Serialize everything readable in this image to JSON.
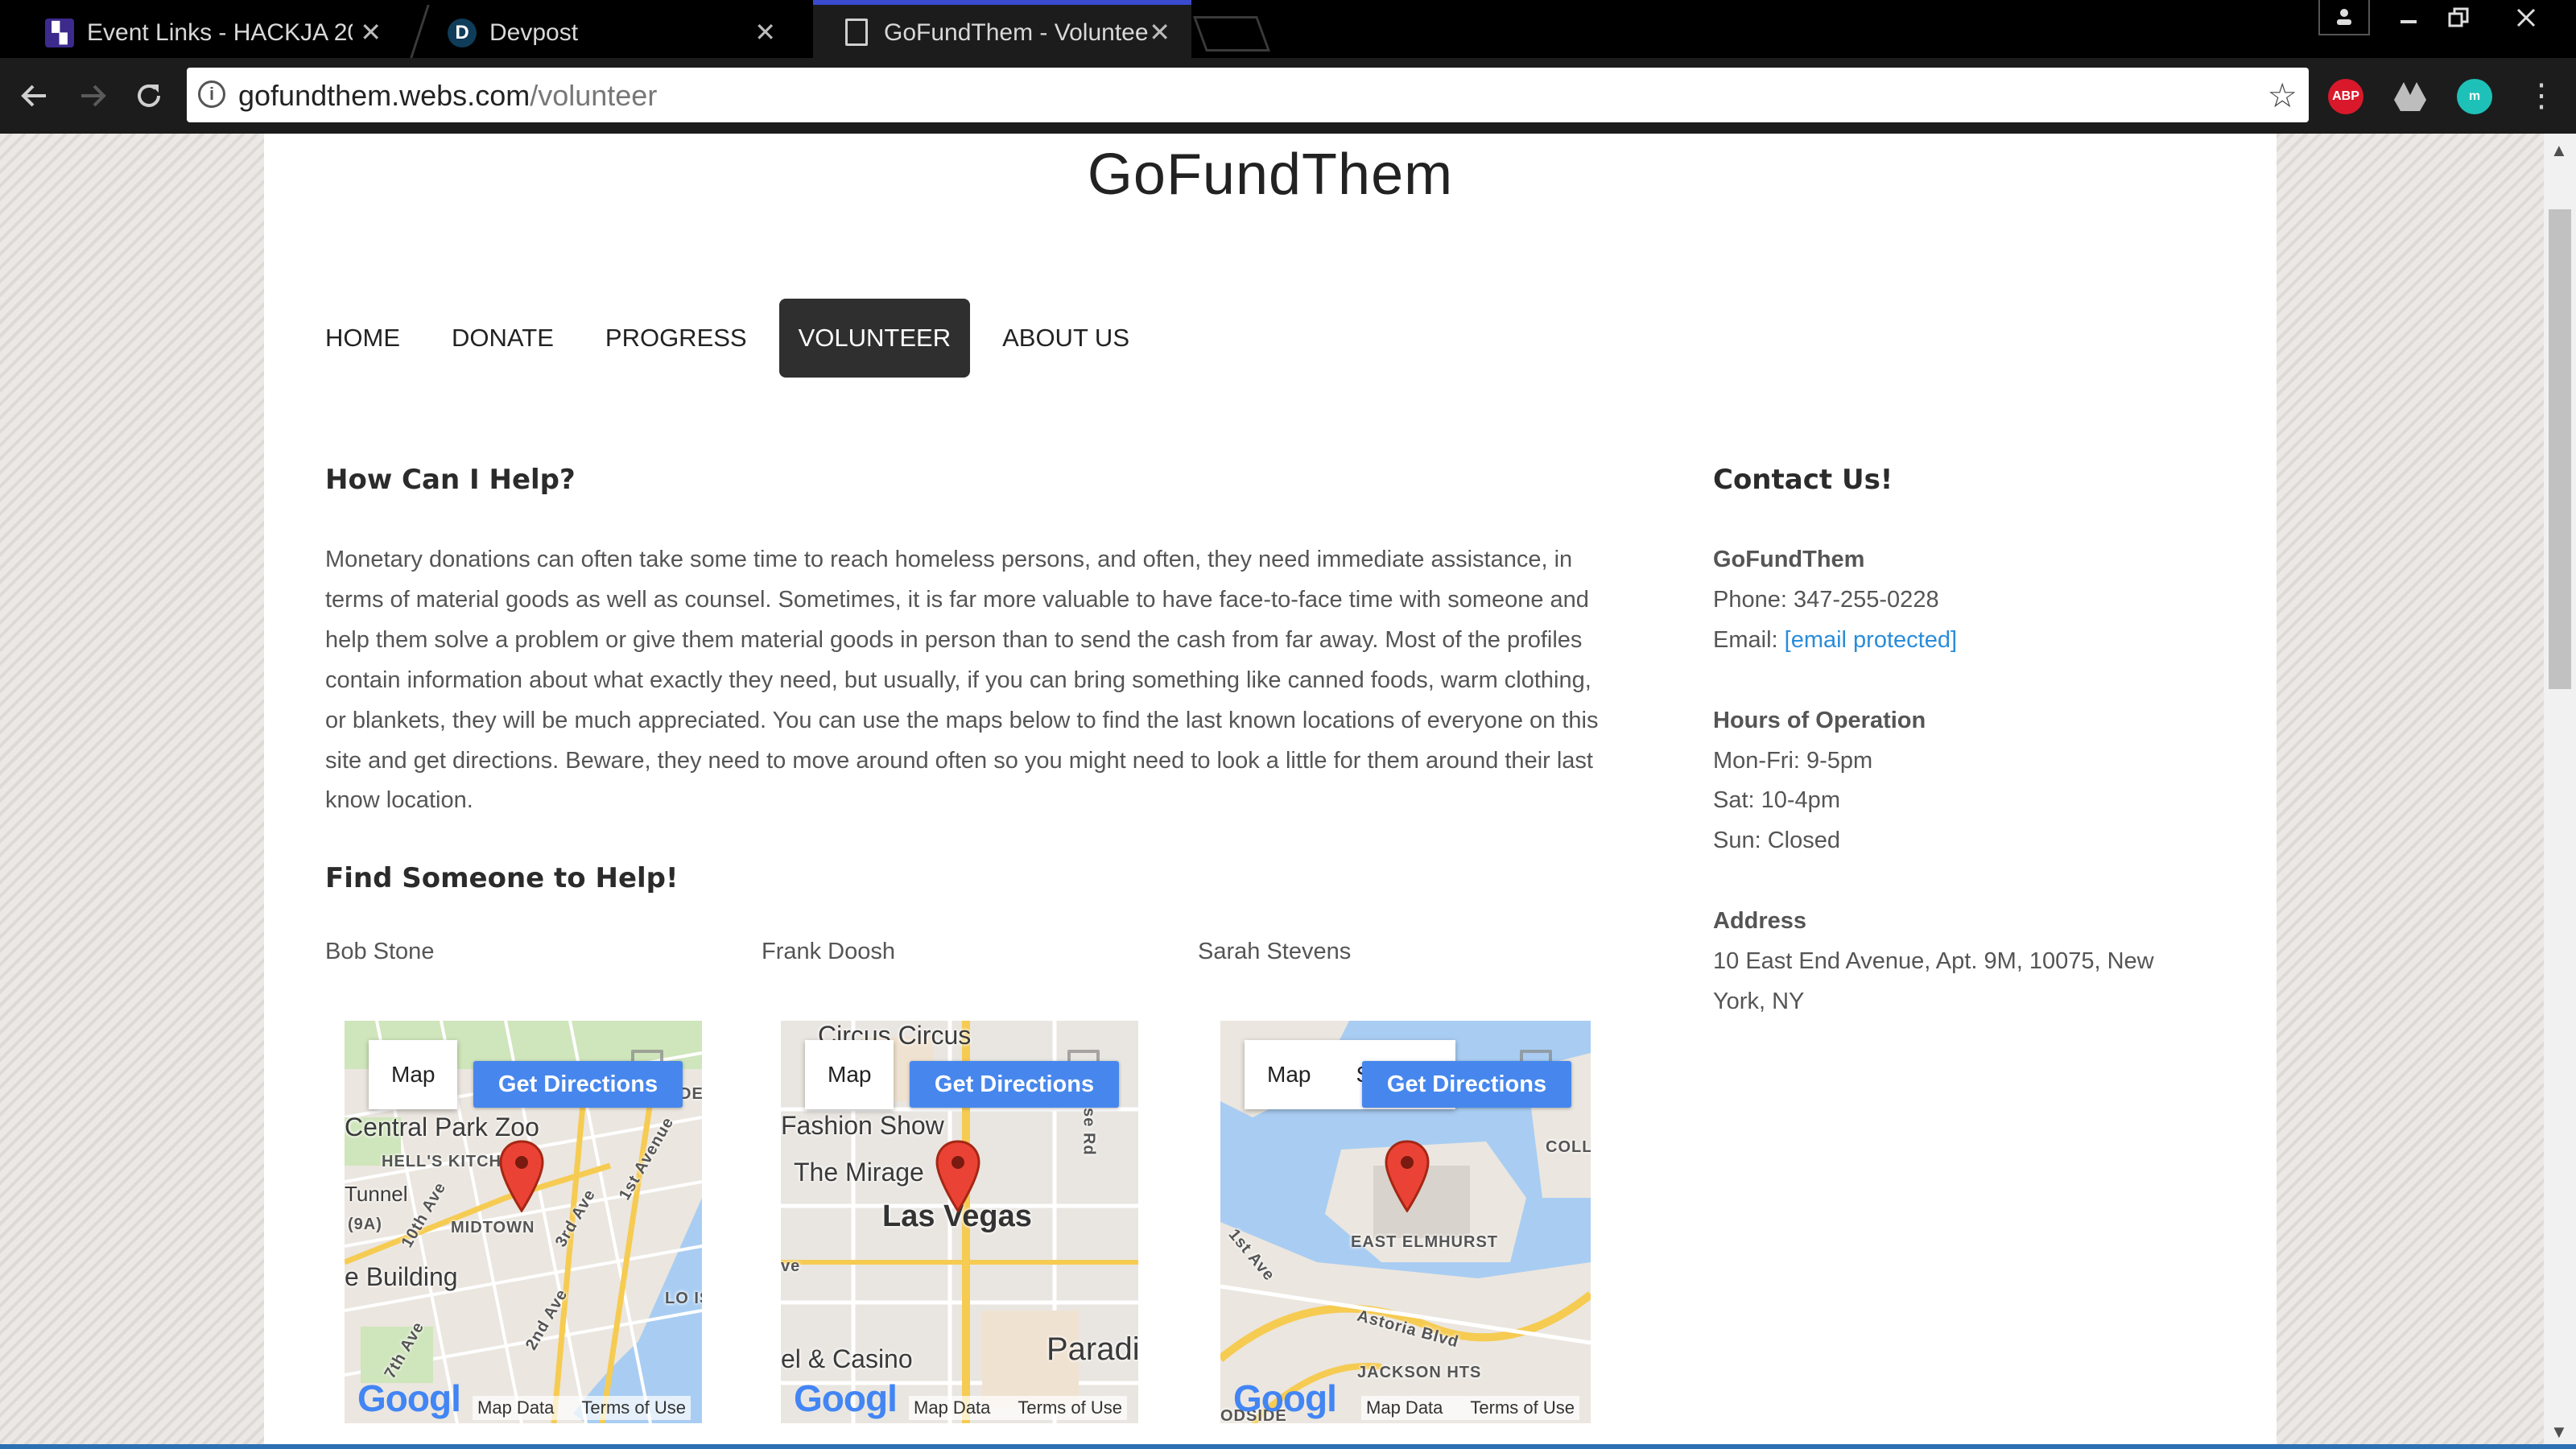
{
  "browser": {
    "tabs": [
      {
        "title": "Event Links - HACKJA 20",
        "favicon": "hackja-icon",
        "active": false
      },
      {
        "title": "Devpost",
        "favicon_letter": "D",
        "active": false
      },
      {
        "title": "GoFundThem - Voluntee",
        "favicon": "document-icon",
        "active": true
      }
    ],
    "close_glyph": "✕",
    "url_host": "gofundthem.webs.com",
    "url_path": "/volunteer",
    "info_glyph": "i",
    "star_glyph": "☆",
    "extensions": [
      {
        "name": "adblock-plus-icon",
        "label": "ABP",
        "color": "#d9192b"
      },
      {
        "name": "google-drive-icon",
        "label": "",
        "color": "#bdbdbd"
      },
      {
        "name": "extension-m-icon",
        "label": "m",
        "color": "#1ec1b8"
      }
    ]
  },
  "site": {
    "title": "GoFundThem",
    "nav": [
      {
        "label": "HOME",
        "active": false
      },
      {
        "label": "DONATE",
        "active": false
      },
      {
        "label": "PROGRESS",
        "active": false
      },
      {
        "label": "VOLUNTEER",
        "active": true
      },
      {
        "label": "ABOUT US",
        "active": false
      }
    ]
  },
  "main": {
    "help_heading": "How Can I Help?",
    "help_text": "Monetary donations can often take some time to reach homeless persons, and often, they need immediate assistance, in terms of material goods as well as counsel. Sometimes, it is far more valuable to have face-to-face time with someone and help them solve a problem or give them material goods in person than to send the cash from far away. Most of the profiles contain information about what exactly they need, but usually, if you can bring something like canned foods, warm clothing, or blankets, they will be much appreciated. You can use the maps below to find the last known locations of everyone on this site and get directions. Beware, they need to move around often so you might need to look a little for them around their last know location.",
    "find_heading": "Find Someone to Help!",
    "people": [
      {
        "name": "Bob Stone",
        "map": {
          "type_label": "Map",
          "directions_label": "Get Directions",
          "labels": [
            "Central Park Zoo",
            "HELL'S KITCHEN",
            "Tunnel",
            "MIDTOWN",
            "e Building",
            "10th Ave",
            "3rd Ave",
            "1st Avenue",
            "2nd Ave",
            "7th Ave",
            "(9A)",
            "LO ISLAN",
            "DE"
          ],
          "google": "Googl",
          "attrib": [
            "Map Data",
            "Terms of Use"
          ]
        }
      },
      {
        "name": "Frank Doosh",
        "map": {
          "type_label": "Map",
          "directions_label": "Get Directions",
          "labels": [
            "Circus Circus",
            "Fashion Show",
            "The Mirage",
            "Las Vegas",
            "el & Casino",
            "Paradi",
            "aradise Rd",
            "ve"
          ],
          "google": "Googl",
          "attrib": [
            "Map Data",
            "Terms of Use"
          ]
        }
      },
      {
        "name": "Sarah Stevens",
        "map": {
          "type_label": "Map",
          "type_label_2": "S",
          "directions_label": "Get Directions",
          "labels": [
            "COLL",
            "EAST ELMHURST",
            "1st Ave",
            "Astoria Blvd",
            "JACKSON HTS",
            "ODSIDE"
          ],
          "google": "Googl",
          "attrib": [
            "Map Data",
            "Terms of Use"
          ]
        }
      }
    ]
  },
  "contact": {
    "heading": "Contact Us!",
    "org": "GoFundThem",
    "phone": "Phone: 347-255-0228",
    "email_prefix": "Email: ",
    "email_link": "[email protected]",
    "hours_heading": "Hours of Operation",
    "hours": [
      "Mon-Fri: 9-5pm",
      "Sat: 10-4pm",
      "Sun: Closed"
    ],
    "address_heading": "Address",
    "address": "10 East End Avenue, Apt. 9M, 10075, New York, NY"
  }
}
